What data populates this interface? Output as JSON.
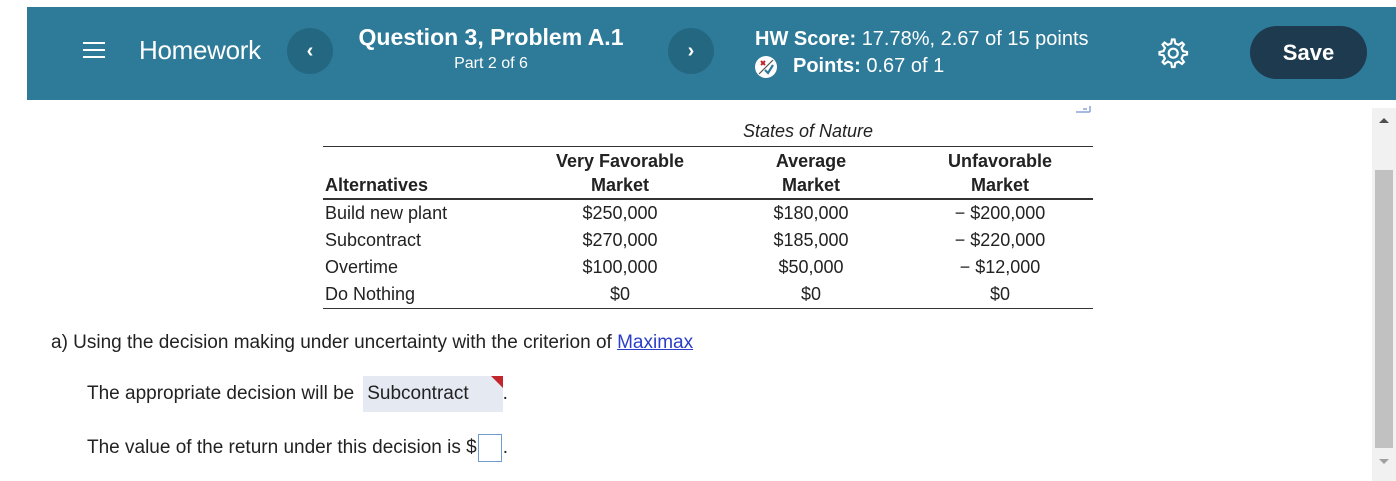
{
  "header": {
    "homework_label": "Homework",
    "question_title": "Question 3, Problem A.1",
    "question_part": "Part 2 of 6",
    "hw_score_label": "HW Score:",
    "hw_score_value": "17.78%, 2.67 of 15 points",
    "points_label": "Points:",
    "points_value": "0.67 of 1",
    "save_label": "Save",
    "prev_symbol": "‹",
    "next_symbol": "›",
    "accent_color": "#2e7a99",
    "save_color": "#1e3a4f"
  },
  "table": {
    "group_header": "States of Nature",
    "columns": [
      {
        "line1": "",
        "line2": "Alternatives"
      },
      {
        "line1": "Very Favorable",
        "line2": "Market"
      },
      {
        "line1": "Average",
        "line2": "Market"
      },
      {
        "line1": "Unfavorable",
        "line2": "Market"
      }
    ],
    "rows": [
      {
        "alt": "Build new plant",
        "vf": "$250,000",
        "avg": "$180,000",
        "unf": "− $200,000"
      },
      {
        "alt": "Subcontract",
        "vf": "$270,000",
        "avg": "$185,000",
        "unf": "− $220,000"
      },
      {
        "alt": "Overtime",
        "vf": "$100,000",
        "avg": "$50,000",
        "unf": "− $12,000"
      },
      {
        "alt": "Do Nothing",
        "vf": "$0",
        "avg": "$0",
        "unf": "$0"
      }
    ]
  },
  "question": {
    "prompt": "a) Using the decision making under uncertainty with the criterion of ",
    "criterion_link": "Maximax",
    "decision_prefix": "The appropriate decision will be",
    "decision_value": "Subcontract",
    "decision_suffix": ".",
    "value_prefix": "The value of the return under this decision is $",
    "value_input": "",
    "value_suffix": "."
  }
}
